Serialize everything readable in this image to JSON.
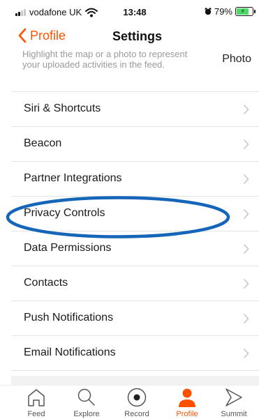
{
  "status_bar": {
    "carrier": "vodafone UK",
    "time": "13:48",
    "battery_percent": "79%",
    "battery_level": 0.79,
    "signal_bars_active": 2,
    "signal_bars_total": 4
  },
  "nav": {
    "back_label": "Profile",
    "title": "Settings",
    "accent_color": "#fc5200"
  },
  "partial_item": {
    "description": "Highlight the map or a photo to represent your uploaded activities in the feed.",
    "value": "Photo"
  },
  "items": [
    {
      "label": "Siri & Shortcuts"
    },
    {
      "label": "Beacon"
    },
    {
      "label": "Partner Integrations"
    },
    {
      "label": "Privacy Controls",
      "circled": true
    },
    {
      "label": "Data Permissions"
    },
    {
      "label": "Contacts"
    },
    {
      "label": "Push Notifications"
    },
    {
      "label": "Email Notifications"
    }
  ],
  "annotation": {
    "shape": "ellipse",
    "color": "#1565b8",
    "target": "Privacy Controls"
  },
  "tab_bar": {
    "active_tab": "Profile",
    "tabs": [
      {
        "label": "Feed",
        "icon": "home-icon"
      },
      {
        "label": "Explore",
        "icon": "magnifier-icon"
      },
      {
        "label": "Record",
        "icon": "record-icon"
      },
      {
        "label": "Profile",
        "icon": "person-icon"
      },
      {
        "label": "Summit",
        "icon": "summit-chevron-icon"
      }
    ]
  }
}
